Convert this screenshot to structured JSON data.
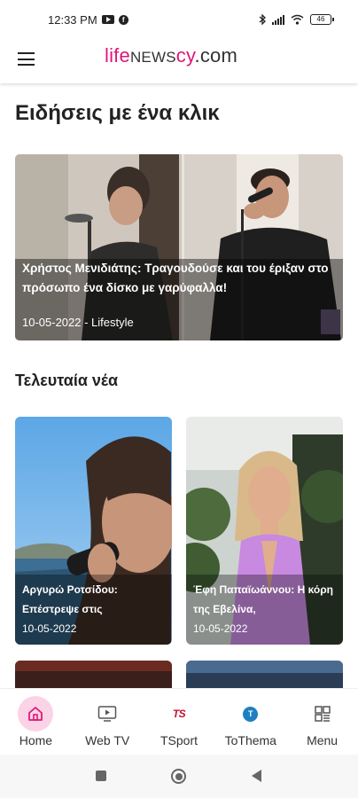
{
  "status_bar": {
    "time": "12:33 PM",
    "battery": "46"
  },
  "header": {
    "logo": {
      "part1": "life",
      "part2": "NEWS",
      "part3": "cy",
      "part4": ".com"
    },
    "menu_icon": "hamburger-icon"
  },
  "main_section": {
    "title": "Ειδήσεις με ένα κλικ"
  },
  "featured": {
    "title": "Χρήστος Μενιδιάτης: Τραγουδούσε και του έριξαν στο πρόσωπο ένα δίσκο με γαρύφαλλα!",
    "meta": "10-05-2022 - Lifestyle"
  },
  "latest_section": {
    "title": "Τελευταία νέα"
  },
  "latest_news": [
    {
      "title": "Αργυρώ Ροτσίδου: Επέστρεψε στις",
      "date": "10-05-2022"
    },
    {
      "title": "Έφη Παπαϊωάννου: Η κόρη της Εβελίνα,",
      "date": "10-05-2022"
    }
  ],
  "bottom_nav": [
    {
      "label": "Home",
      "icon": "home-icon",
      "active": true
    },
    {
      "label": "Web TV",
      "icon": "tv-play-icon"
    },
    {
      "label": "TSport",
      "icon": "tsport-logo-icon",
      "icon_text": "TS"
    },
    {
      "label": "ToThema",
      "icon": "tothema-logo-icon",
      "icon_text": "T"
    },
    {
      "label": "Menu",
      "icon": "menu-grid-icon"
    }
  ],
  "colors": {
    "brand_pink": "#e0177a",
    "nav_active_bg": "#fbd3e6",
    "tsport_red": "#c8102e",
    "tothema_blue": "#1e7fc3"
  }
}
